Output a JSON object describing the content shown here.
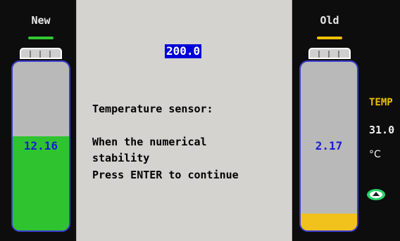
{
  "left_cell": {
    "label": "New",
    "value": "12.16",
    "fill_level": 0.56,
    "fill_color": "#2fc42f",
    "indicator_color": "#32c832",
    "value_color": "#1a1ad8"
  },
  "right_cell": {
    "label": "Old",
    "value": "2.17",
    "fill_level": 0.1,
    "fill_color": "#f2c21c",
    "indicator_color": "#f0c000",
    "value_color": "#1a1ad8"
  },
  "dialog": {
    "value": "200.0",
    "title": "Temperature sensor:",
    "line1": "When the numerical",
    "line2": "stability",
    "line3": "Press ENTER to continue"
  },
  "temperature": {
    "label": "TEMP",
    "value": "31.0",
    "unit": "°C"
  },
  "icons": {
    "stir": "stirrer-icon"
  }
}
